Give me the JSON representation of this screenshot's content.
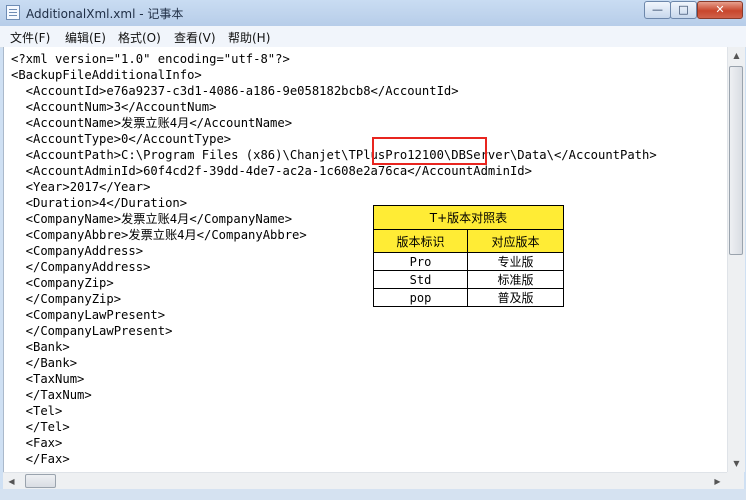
{
  "window": {
    "title": "AdditionalXml.xml - 记事本",
    "controls": {
      "minimize": "—",
      "maximize": "□",
      "close": "✕"
    }
  },
  "menu": [
    "文件(F)",
    "编辑(E)",
    "格式(O)",
    "查看(V)",
    "帮助(H)"
  ],
  "editor": {
    "lines": [
      "<?xml version=\"1.0\" encoding=\"utf-8\"?>",
      "<BackupFileAdditionalInfo>",
      "  <AccountId>e76a9237-c3d1-4086-a186-9e058182bcb8</AccountId>",
      "  <AccountNum>3</AccountNum>",
      "  <AccountName>发票立账4月</AccountName>",
      "  <AccountType>0</AccountType>",
      "  <AccountPath>C:\\Program Files (x86)\\Chanjet\\TPlusPro12100\\DBServer\\Data\\</AccountPath>",
      "  <AccountAdminId>60f4cd2f-39dd-4de7-ac2a-1c608e2a76ca</AccountAdminId>",
      "  <Year>2017</Year>",
      "  <Duration>4</Duration>",
      "  <CompanyName>发票立账4月</CompanyName>",
      "  <CompanyAbbre>发票立账4月</CompanyAbbre>",
      "  <CompanyAddress>",
      "  </CompanyAddress>",
      "  <CompanyZip>",
      "  </CompanyZip>",
      "  <CompanyLawPresent>",
      "  </CompanyLawPresent>",
      "  <Bank>",
      "  </Bank>",
      "  <TaxNum>",
      "  </TaxNum>",
      "  <Tel>",
      "  </Tel>",
      "  <Fax>",
      "  </Fax>"
    ]
  },
  "version_table": {
    "title": "T+版本对照表",
    "headers": [
      "版本标识",
      "对应版本"
    ],
    "rows": [
      [
        "Pro",
        "专业版"
      ],
      [
        "Std",
        "标准版"
      ],
      [
        "pop",
        "普及版"
      ]
    ]
  },
  "colors": {
    "highlight_box": "#e8251f",
    "table_header_bg": "#ffec35"
  }
}
